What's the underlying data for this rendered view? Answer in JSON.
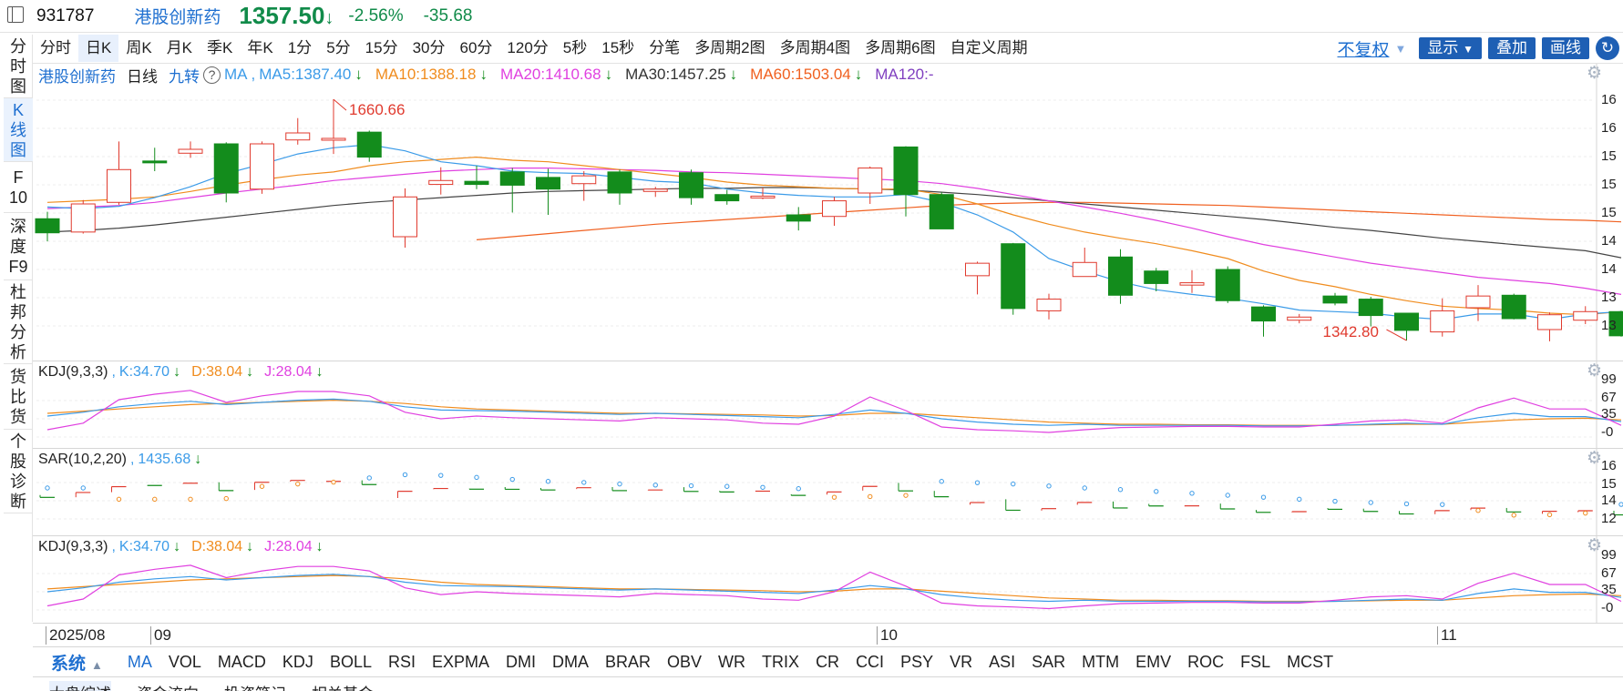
{
  "header": {
    "code": "931787",
    "name": "港股创新药",
    "price": "1357.50",
    "pct": "-2.56%",
    "chg": "-35.68"
  },
  "sidebar": [
    {
      "chars": [
        "分",
        "时",
        "图"
      ]
    },
    {
      "chars": [
        "K",
        "线",
        "图"
      ],
      "active": true
    },
    {
      "chars": [
        "F",
        "10"
      ]
    },
    {
      "chars": [
        "深",
        "度",
        "F9"
      ]
    },
    {
      "chars": [
        "杜",
        "邦",
        "分",
        "析"
      ]
    },
    {
      "chars": [
        "货",
        "比",
        "货"
      ]
    },
    {
      "chars": [
        "个",
        "股",
        "诊",
        "断"
      ]
    }
  ],
  "periods": [
    "分时",
    "日K",
    "周K",
    "月K",
    "季K",
    "年K",
    "1分",
    "5分",
    "15分",
    "30分",
    "60分",
    "120分",
    "5秒",
    "15秒",
    "分笔",
    "多周期2图",
    "多周期4图",
    "多周期6图",
    "自定义周期"
  ],
  "tools": {
    "adjust": "不复权",
    "show": "显示",
    "overlay": "叠加",
    "draw": "画线"
  },
  "main_legend": {
    "name": "港股创新药",
    "period": "日线",
    "jiuzhuan": "九转",
    "ma": "MA",
    "ma5": "MA5:1387.40",
    "ma10": "MA10:1388.18",
    "ma20": "MA20:1410.68",
    "ma30": "MA30:1457.25",
    "ma60": "MA60:1503.04",
    "ma120": "MA120:-"
  },
  "annot": {
    "high": "1660.66",
    "low": "1342.80"
  },
  "kdj": {
    "name": "KDJ(9,3,3)",
    "k": "K:34.70",
    "d": "D:38.04",
    "j": "J:28.04"
  },
  "sar": {
    "name": "SAR(10,2,20)",
    "v": "1435.68"
  },
  "axis": {
    "main": [
      "16",
      "16",
      "15",
      "15",
      "15",
      "14",
      "14",
      "13",
      "13"
    ],
    "kdj": [
      "99",
      "67",
      "35",
      "-0"
    ],
    "sar": [
      "16",
      "15",
      "14",
      "12"
    ],
    "kdj2": [
      "99",
      "67",
      "35",
      "-0"
    ],
    "dates": [
      "2025/08",
      "09",
      "10",
      "11"
    ]
  },
  "indicators": [
    "MA",
    "VOL",
    "MACD",
    "KDJ",
    "BOLL",
    "RSI",
    "EXPMA",
    "DMI",
    "DMA",
    "BRAR",
    "OBV",
    "WR",
    "TRIX",
    "CR",
    "CCI",
    "PSY",
    "VR",
    "ASI",
    "SAR",
    "MTM",
    "EMV",
    "ROC",
    "FSL",
    "MCST"
  ],
  "system_label": "系统",
  "bottom_tabs": [
    "大盘综述",
    "资金流向",
    "投资笔记",
    "相关基金"
  ],
  "colors": {
    "up": "#e03a2e",
    "down": "#138c1c",
    "ma5": "#3b9be8",
    "ma10": "#f08c1e",
    "ma20": "#e040e0",
    "ma30": "#444444",
    "ma60": "#f06020",
    "ma120": "#8040c0"
  },
  "chart_data": {
    "type": "candlestick",
    "candles": [
      {
        "o": 1507,
        "h": 1516,
        "l": 1478,
        "c": 1489
      },
      {
        "o": 1490,
        "h": 1531,
        "l": 1488,
        "c": 1526
      },
      {
        "o": 1528,
        "h": 1606,
        "l": 1525,
        "c": 1570
      },
      {
        "o": 1581,
        "h": 1598,
        "l": 1568,
        "c": 1579
      },
      {
        "o": 1591,
        "h": 1606,
        "l": 1585,
        "c": 1596
      },
      {
        "o": 1603,
        "h": 1605,
        "l": 1528,
        "c": 1540
      },
      {
        "o": 1545,
        "h": 1606,
        "l": 1539,
        "c": 1603
      },
      {
        "o": 1608,
        "h": 1636,
        "l": 1602,
        "c": 1617
      },
      {
        "o": 1609,
        "h": 1660,
        "l": 1590,
        "c": 1610
      },
      {
        "o": 1618,
        "h": 1620,
        "l": 1580,
        "c": 1586
      },
      {
        "o": 1484,
        "h": 1546,
        "l": 1470,
        "c": 1535
      },
      {
        "o": 1551,
        "h": 1573,
        "l": 1538,
        "c": 1556
      },
      {
        "o": 1555,
        "h": 1575,
        "l": 1545,
        "c": 1551
      },
      {
        "o": 1567,
        "h": 1572,
        "l": 1515,
        "c": 1550
      },
      {
        "o": 1560,
        "h": 1571,
        "l": 1512,
        "c": 1545
      },
      {
        "o": 1552,
        "h": 1568,
        "l": 1530,
        "c": 1562
      },
      {
        "o": 1567,
        "h": 1570,
        "l": 1525,
        "c": 1540
      },
      {
        "o": 1542,
        "h": 1548,
        "l": 1535,
        "c": 1545
      },
      {
        "o": 1566,
        "h": 1570,
        "l": 1525,
        "c": 1534
      },
      {
        "o": 1538,
        "h": 1544,
        "l": 1525,
        "c": 1530
      },
      {
        "o": 1534,
        "h": 1547,
        "l": 1532,
        "c": 1536
      },
      {
        "o": 1512,
        "h": 1522,
        "l": 1492,
        "c": 1504
      },
      {
        "o": 1510,
        "h": 1535,
        "l": 1498,
        "c": 1530
      },
      {
        "o": 1540,
        "h": 1574,
        "l": 1526,
        "c": 1572
      },
      {
        "o": 1599,
        "h": 1600,
        "l": 1510,
        "c": 1538
      },
      {
        "o": 1538,
        "h": 1541,
        "l": 1494,
        "c": 1494
      },
      {
        "o": 1434,
        "h": 1452,
        "l": 1410,
        "c": 1450
      },
      {
        "o": 1475,
        "h": 1476,
        "l": 1384,
        "c": 1392
      },
      {
        "o": 1389,
        "h": 1411,
        "l": 1378,
        "c": 1404
      },
      {
        "o": 1433,
        "h": 1470,
        "l": 1433,
        "c": 1451
      },
      {
        "o": 1458,
        "h": 1468,
        "l": 1398,
        "c": 1409
      },
      {
        "o": 1440,
        "h": 1444,
        "l": 1414,
        "c": 1424
      },
      {
        "o": 1422,
        "h": 1441,
        "l": 1412,
        "c": 1425
      },
      {
        "o": 1442,
        "h": 1446,
        "l": 1399,
        "c": 1402
      },
      {
        "o": 1394,
        "h": 1396,
        "l": 1356,
        "c": 1376
      },
      {
        "o": 1377,
        "h": 1385,
        "l": 1373,
        "c": 1381
      },
      {
        "o": 1408,
        "h": 1412,
        "l": 1396,
        "c": 1399
      },
      {
        "o": 1404,
        "h": 1407,
        "l": 1369,
        "c": 1383
      },
      {
        "o": 1386,
        "h": 1386,
        "l": 1351,
        "c": 1364
      },
      {
        "o": 1362,
        "h": 1405,
        "l": 1356,
        "c": 1389
      },
      {
        "o": 1393,
        "h": 1422,
        "l": 1376,
        "c": 1408
      },
      {
        "o": 1409,
        "h": 1411,
        "l": 1378,
        "c": 1379
      },
      {
        "o": 1365,
        "h": 1387,
        "l": 1350,
        "c": 1384
      },
      {
        "o": 1377,
        "h": 1395,
        "l": 1372,
        "c": 1388
      },
      {
        "o": 1388,
        "h": 1389,
        "l": 1356,
        "c": 1357
      }
    ],
    "ma5": [
      1522,
      1520,
      1523,
      1534,
      1548,
      1565,
      1577,
      1590,
      1598,
      1602,
      1594,
      1580,
      1575,
      1568,
      1566,
      1565,
      1560,
      1555,
      1553,
      1545,
      1540,
      1537,
      1535,
      1535,
      1538,
      1528,
      1512,
      1490,
      1456,
      1440,
      1426,
      1416,
      1410,
      1405,
      1398,
      1390,
      1388,
      1386,
      1381,
      1378,
      1385,
      1385,
      1378,
      1385,
      1388
    ],
    "ma10": [
      1528,
      1530,
      1532,
      1535,
      1542,
      1550,
      1557,
      1563,
      1567,
      1575,
      1580,
      1583,
      1586,
      1582,
      1580,
      1575,
      1570,
      1565,
      1560,
      1554,
      1550,
      1548,
      1546,
      1545,
      1545,
      1538,
      1526,
      1512,
      1500,
      1490,
      1482,
      1475,
      1466,
      1456,
      1440,
      1428,
      1420,
      1410,
      1402,
      1395,
      1392,
      1390,
      1386,
      1384,
      1388
    ],
    "ma20": [
      1520,
      1522,
      1524,
      1528,
      1534,
      1540,
      1545,
      1550,
      1556,
      1560,
      1564,
      1568,
      1570,
      1572,
      1572,
      1571,
      1570,
      1569,
      1567,
      1566,
      1564,
      1562,
      1560,
      1558,
      1556,
      1552,
      1546,
      1538,
      1530,
      1522,
      1514,
      1505,
      1495,
      1484,
      1474,
      1466,
      1458,
      1450,
      1444,
      1438,
      1432,
      1428,
      1424,
      1418,
      1410
    ],
    "ma30": [
      1490,
      1492,
      1495,
      1499,
      1504,
      1509,
      1514,
      1519,
      1524,
      1528,
      1531,
      1534,
      1537,
      1540,
      1542,
      1543,
      1544,
      1545,
      1546,
      1546,
      1547,
      1547,
      1546,
      1545,
      1544,
      1541,
      1538,
      1534,
      1530,
      1526,
      1522,
      1518,
      1514,
      1510,
      1506,
      1501,
      1496,
      1492,
      1487,
      1482,
      1478,
      1474,
      1470,
      1466,
      1457
    ],
    "ma60": [
      null,
      null,
      null,
      null,
      null,
      null,
      null,
      null,
      null,
      null,
      null,
      null,
      1480,
      1484,
      1488,
      1492,
      1496,
      1500,
      1503,
      1506,
      1509,
      1512,
      1515,
      1518,
      1521,
      1524,
      1526,
      1527,
      1528,
      1528,
      1527,
      1526,
      1525,
      1524,
      1522,
      1520,
      1518,
      1516,
      1514,
      1512,
      1510,
      1508,
      1506,
      1505,
      1503
    ],
    "kdj_k": [
      45,
      52,
      62,
      68,
      72,
      66,
      70,
      74,
      76,
      72,
      62,
      56,
      55,
      54,
      52,
      50,
      48,
      50,
      48,
      46,
      44,
      42,
      48,
      56,
      50,
      40,
      34,
      30,
      28,
      30,
      28,
      28,
      28,
      28,
      27,
      27,
      28,
      30,
      32,
      30,
      42,
      50,
      44,
      44,
      35
    ],
    "kdj_d": [
      50,
      54,
      58,
      62,
      66,
      68,
      70,
      72,
      74,
      72,
      68,
      62,
      58,
      56,
      54,
      52,
      50,
      50,
      49,
      48,
      47,
      45,
      46,
      50,
      50,
      46,
      42,
      38,
      34,
      32,
      30,
      30,
      29,
      29,
      28,
      28,
      28,
      29,
      30,
      30,
      34,
      38,
      40,
      41,
      38
    ],
    "kdj_j": [
      20,
      32,
      75,
      85,
      92,
      70,
      82,
      90,
      90,
      82,
      52,
      40,
      45,
      42,
      40,
      38,
      36,
      42,
      40,
      38,
      32,
      30,
      45,
      80,
      55,
      25,
      20,
      18,
      15,
      20,
      24,
      25,
      26,
      26,
      25,
      25,
      30,
      36,
      38,
      32,
      60,
      78,
      58,
      58,
      28
    ],
    "sar": [
      1560,
      1560,
      1475,
      1475,
      1475,
      1480,
      1572,
      1590,
      1604,
      1636,
      1660,
      1655,
      1640,
      1625,
      1610,
      1602,
      1590,
      1582,
      1577,
      1572,
      1565,
      1555,
      1490,
      1495,
      1504,
      1610,
      1600,
      1590,
      1575,
      1560,
      1548,
      1534,
      1520,
      1505,
      1490,
      1475,
      1460,
      1450,
      1440,
      1435,
      1390,
      1355,
      1358,
      1370,
      1436
    ]
  }
}
